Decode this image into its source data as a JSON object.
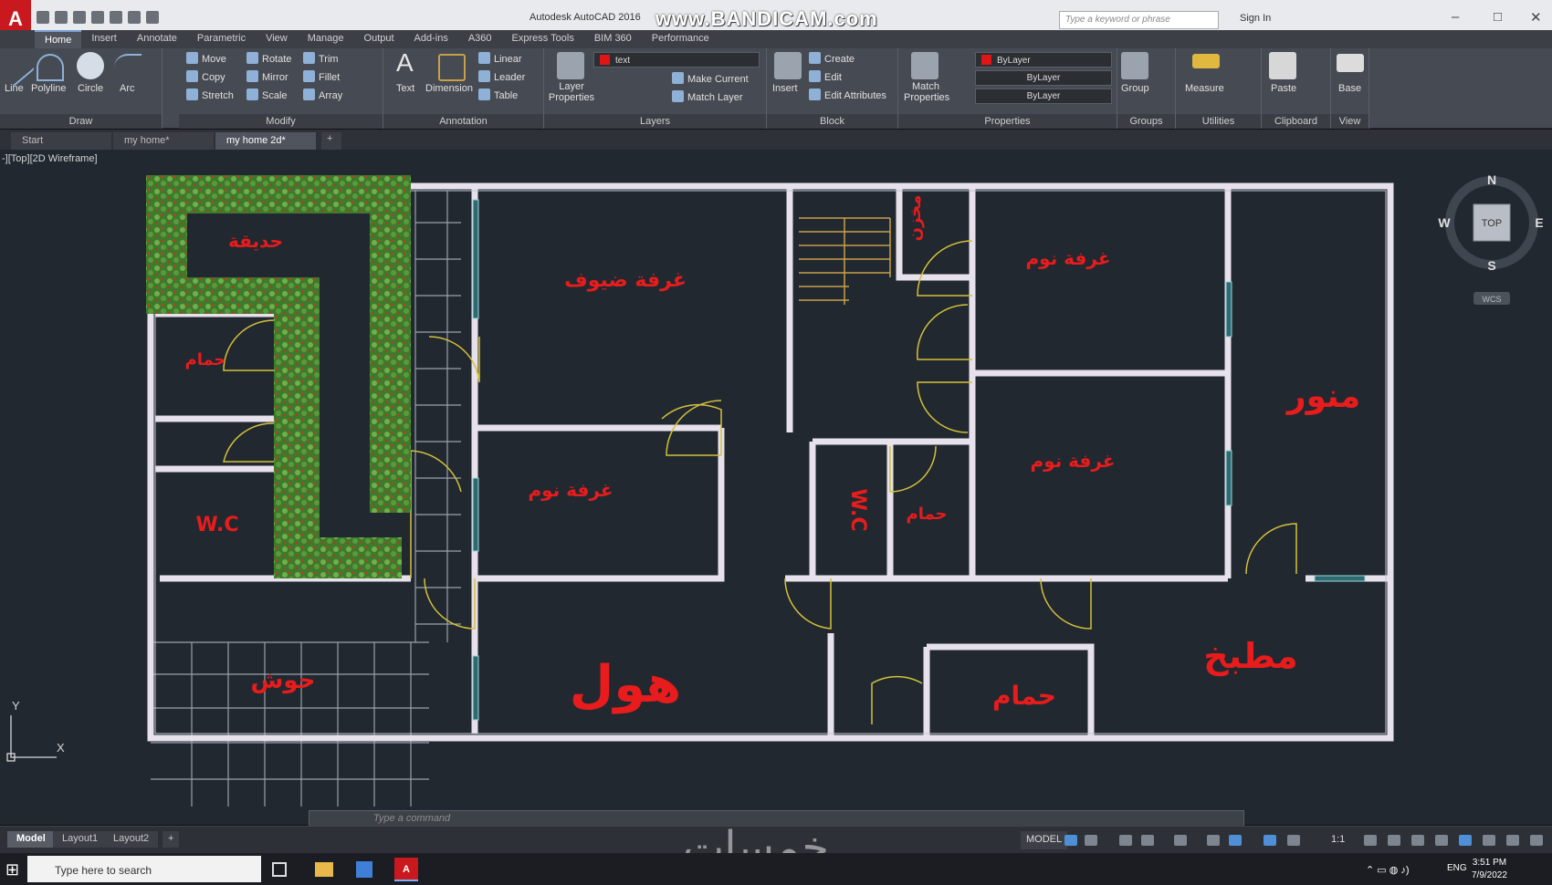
{
  "window": {
    "title": "Autodesk AutoCAD 2016",
    "watermark": "www.BANDICAM.com",
    "search_placeholder": "Type a keyword or phrase",
    "sign_in": "Sign In"
  },
  "ribbon_tabs": [
    "Home",
    "Insert",
    "Annotate",
    "Parametric",
    "View",
    "Manage",
    "Output",
    "Add-ins",
    "A360",
    "Express Tools",
    "BIM 360",
    "Performance"
  ],
  "ribbon": {
    "draw": {
      "title": "Draw",
      "tools": [
        "Line",
        "Polyline",
        "Circle",
        "Arc"
      ]
    },
    "modify": {
      "title": "Modify",
      "tools": [
        "Move",
        "Rotate",
        "Trim",
        "Copy",
        "Mirror",
        "Fillet",
        "Stretch",
        "Scale",
        "Array"
      ]
    },
    "annotation": {
      "title": "Annotation",
      "tools": [
        "Text",
        "Dimension",
        "Linear",
        "Leader",
        "Table"
      ]
    },
    "layers": {
      "title": "Layers",
      "tools": [
        "Layer Properties",
        "Make Current",
        "Match Layer"
      ],
      "current_layer": "text"
    },
    "block": {
      "title": "Block",
      "tools": [
        "Insert",
        "Create",
        "Edit",
        "Edit Attributes"
      ]
    },
    "properties": {
      "title": "Properties",
      "tools": [
        "Match Properties"
      ],
      "color": "ByLayer",
      "linetype": "ByLayer",
      "lineweight": "ByLayer"
    },
    "groups": {
      "title": "Groups",
      "tools": [
        "Group"
      ]
    },
    "utilities": {
      "title": "Utilities",
      "tools": [
        "Measure"
      ]
    },
    "clipboard": {
      "title": "Clipboard",
      "tools": [
        "Paste"
      ]
    },
    "view": {
      "title": "View",
      "tools": [
        "Base"
      ]
    }
  },
  "doc_tabs": [
    "Start",
    "my home*",
    "my home 2d*"
  ],
  "viewport_label": "-][Top][2D Wireframe]",
  "viewcube": {
    "north": "N",
    "south": "S",
    "east": "E",
    "west": "W",
    "face": "TOP",
    "ucs": "WCS"
  },
  "ucs_axes": {
    "x": "X",
    "y": "Y"
  },
  "rooms": {
    "garden": "حديقة",
    "bath_left": "حمام",
    "wc_left": "W.C",
    "yard": "حوش",
    "guest_room": "غرفة ضيوف",
    "bedroom_left": "غرفة نوم",
    "hall": "هول",
    "storage": "مخزن",
    "wc_center": "W.C",
    "bath_center": "حمام",
    "bath_bottom": "حمام",
    "bedroom_top": "غرفة نوم",
    "bedroom_right": "غرفة نوم",
    "lightwell": "منور",
    "kitchen": "مطبخ"
  },
  "command_line": {
    "placeholder": "Type a command"
  },
  "layout_tabs": [
    "Model",
    "Layout1",
    "Layout2"
  ],
  "status": {
    "model": "MODEL",
    "scale": "1:1"
  },
  "taskbar": {
    "search": "Type here to search",
    "lang": "ENG",
    "time": "3:51 PM",
    "date": "7/9/2022"
  },
  "brand_overlay": "خمسات",
  "colors": {
    "wall": "#e6e1ea",
    "label": "#e81c1c",
    "door": "#d4c13a",
    "canvas": "#212830"
  }
}
